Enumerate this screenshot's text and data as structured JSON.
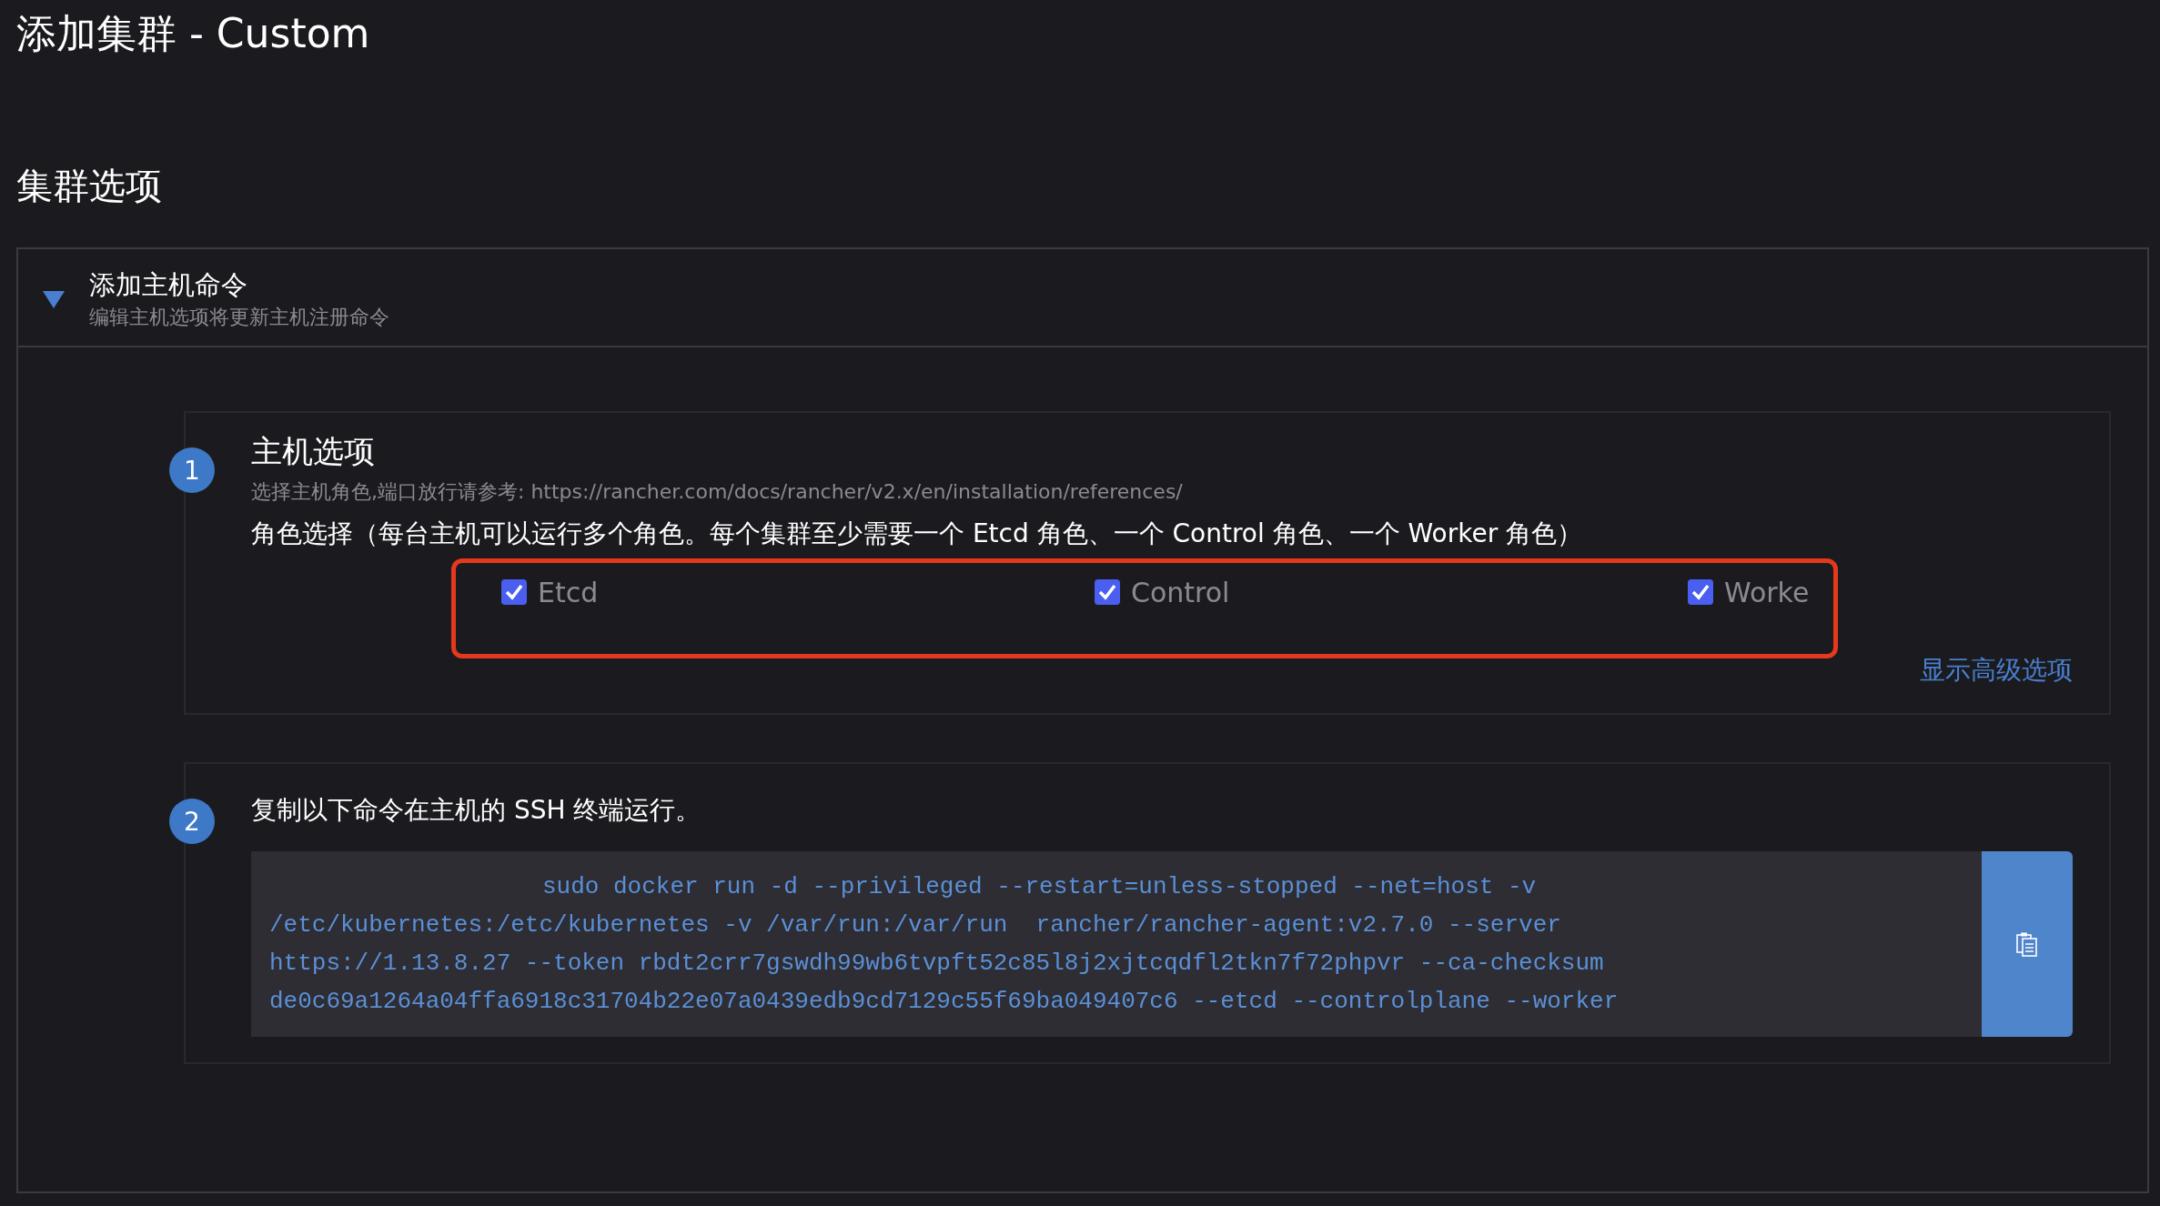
{
  "page_title": "添加集群 - Custom",
  "section_title": "集群选项",
  "accordion": {
    "expanded": true,
    "title": "添加主机命令",
    "subtitle": "编辑主机选项将更新主机注册命令"
  },
  "steps": [
    {
      "number": "1",
      "title": "主机选项",
      "hint": "选择主机角色,端口放行请参考: https://rancher.com/docs/rancher/v2.x/en/installation/references/",
      "roles_label": "角色选择（每台主机可以运行多个角色。每个集群至少需要一个 Etcd 角色、一个 Control 角色、一个 Worker 角色）",
      "roles_highlighted": true,
      "roles": [
        {
          "label": "Etcd",
          "checked": true
        },
        {
          "label": "Control",
          "checked": true
        },
        {
          "label": "Worke",
          "checked": true
        }
      ],
      "link": "显示高级选项"
    },
    {
      "number": "2",
      "title": "复制以下命令在主机的 SSH 终端运行。",
      "command_lines": [
        "sudo docker run -d --privileged --restart=unless-stopped --net=host -v",
        "/etc/kubernetes:/etc/kubernetes -v /var/run:/var/run  rancher/rancher-agent:v2.7.0 --server",
        "https://1.13.8.27 --token rbdt2crr7gswdh99wb6tvpft52c85l8j2xjtcqdfl2tkn7f72phpvr --ca-checksum",
        "de0c69a1264a04ffa6918c31704b22e07a0439edb9cd7129c55f69ba049407c6 --etcd --controlplane --worker"
      ]
    }
  ]
}
